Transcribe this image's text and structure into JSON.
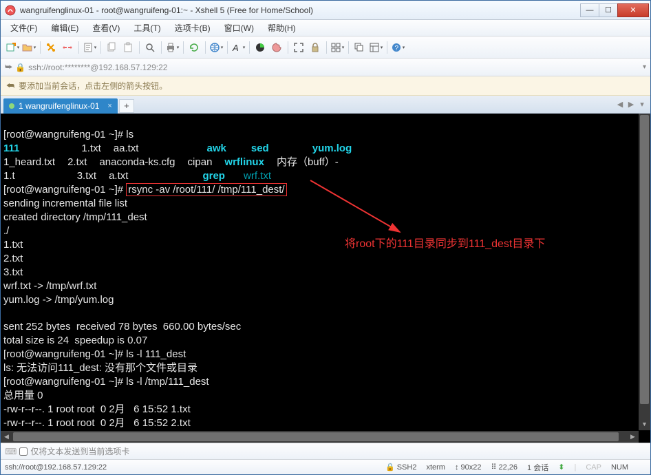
{
  "window": {
    "title": "wangruifenglinux-01 - root@wangruifeng-01:~ - Xshell 5 (Free for Home/School)"
  },
  "menu": {
    "file": "文件(F)",
    "edit": "编辑(E)",
    "view": "查看(V)",
    "tools": "工具(T)",
    "tabs": "选项卡(B)",
    "window": "窗口(W)",
    "help": "帮助(H)"
  },
  "address": {
    "value": "ssh://root:********@192.168.57.129:22"
  },
  "hint": {
    "text": "要添加当前会话，点击左侧的箭头按钮。"
  },
  "tab": {
    "label": "1 wangruifenglinux-01"
  },
  "terminal": {
    "prompt": "[root@wangruifeng-01 ~]#",
    "cmd_ls": "ls",
    "row1": {
      "c1": "111",
      "c2": "1.txt",
      "c3": "aa.txt",
      "c4": "awk",
      "c5": "sed",
      "c6": "yum.log"
    },
    "row2": {
      "c1": "1_heard.txt",
      "c2": "2.txt",
      "c3": "anaconda-ks.cfg",
      "c4": "cipan",
      "c5": "wrflinux",
      "c6": "内存（buff）-"
    },
    "row3": {
      "c1": "1.t",
      "c2": "3.txt",
      "c3": "a.txt",
      "c4": "grep",
      "c5": "wrf.txt"
    },
    "cmd_rsync": "rsync -av /root/111/ /tmp/111_dest/",
    "l_sending": "sending incremental file list",
    "l_created": "created directory /tmp/111_dest",
    "l_dot": "./",
    "l_f1": "1.txt",
    "l_f2": "2.txt",
    "l_f3": "3.txt",
    "l_wrf": "wrf.txt -> /tmp/wrf.txt",
    "l_yum": "yum.log -> /tmp/yum.log",
    "l_sent": "sent 252 bytes  received 78 bytes  660.00 bytes/sec",
    "l_total": "total size is 24  speedup is 0.07",
    "cmd_ls2": "ls -l 111_dest",
    "l_lserr": "ls: 无法访问111_dest: 没有那个文件或目录",
    "cmd_ls3": "ls -l /tmp/111_dest",
    "l_total2": "总用量 0",
    "l_perm1": "-rw-r--r--. 1 root root  0 2月   6 15:52 1.txt",
    "l_perm2": "-rw-r--r--. 1 root root  0 2月   6 15:52 2.txt",
    "annotation": "将root下的111目录同步到111_dest目录下"
  },
  "footer": {
    "check_label": "仅将文本发送到当前选项卡"
  },
  "status": {
    "conn": "ssh://root@192.168.57.129:22",
    "ssh": "SSH2",
    "term": "xterm",
    "size": "90x22",
    "pos": "22,26",
    "sess": "1 会话",
    "cap": "CAP",
    "num": "NUM"
  }
}
